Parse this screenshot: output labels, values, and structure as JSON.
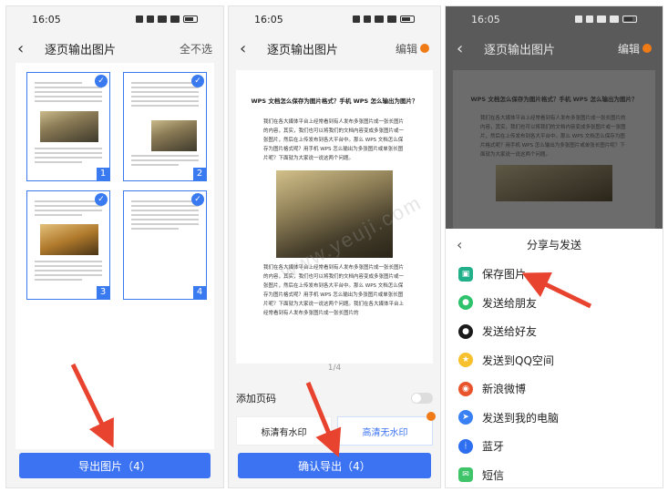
{
  "status": {
    "time": "16:05"
  },
  "panel1": {
    "title": "逐页输出图片",
    "right_action": "全不选",
    "pages": [
      "1",
      "2",
      "3",
      "4"
    ],
    "export_button": "导出图片（4）"
  },
  "panel2": {
    "title": "逐页输出图片",
    "right_action": "编辑",
    "doc_title": "WPS 文档怎么保存为图片格式？手机 WPS 怎么输出为图片？",
    "doc_para1": "我们在各大媒体平台上经常看到有人发布多张图片成一张长图片的内容，其实，我们也可以将我们的文档内容变成多张图片或一张图片，然后在上传发布到各大平台中。那么 WPS 文档怎么保存为图片格式呢？用手机 WPS 怎么输出为多张图片或单张长图片呢？下面就为大家说一说这两个问题。",
    "doc_para2": "我们在各大媒体平台上经常看到有人发布多张图片成一张长图片的内容，其实，我们也可以将我们的文档内容变成多张图片或一张图片，然后在上传发布到各大平台中。那么 WPS 文档怎么保存为图片格式呢？用手机 WPS 怎么输出为多张图片或单张长图片呢？下面就为大家说一说这两个问题。我们在各大媒体平台上经常看到有人发布多张图片成一张长图片的",
    "page_indicator": "1/4",
    "add_page_number": "添加页码",
    "quality_watermark": "标清有水印",
    "quality_nowatermark": "高清无水印",
    "confirm_button": "确认导出（4）"
  },
  "panel3": {
    "title": "逐页输出图片",
    "right_action": "编辑",
    "sheet_title": "分享与发送",
    "items": [
      {
        "label": "保存图片",
        "icon": "photo-icon"
      },
      {
        "label": "发送给朋友",
        "icon": "wechat-icon"
      },
      {
        "label": "发送给好友",
        "icon": "qq-icon"
      },
      {
        "label": "发送到QQ空间",
        "icon": "qzone-star-icon"
      },
      {
        "label": "新浪微博",
        "icon": "weibo-icon"
      },
      {
        "label": "发送到我的电脑",
        "icon": "computer-icon"
      },
      {
        "label": "蓝牙",
        "icon": "bluetooth-icon"
      },
      {
        "label": "短信",
        "icon": "sms-icon"
      }
    ]
  },
  "watermark": "www.yeuji.com",
  "colors": {
    "accent": "#3b73f2",
    "arrow": "#e8432e",
    "crown": "#f07a16"
  }
}
